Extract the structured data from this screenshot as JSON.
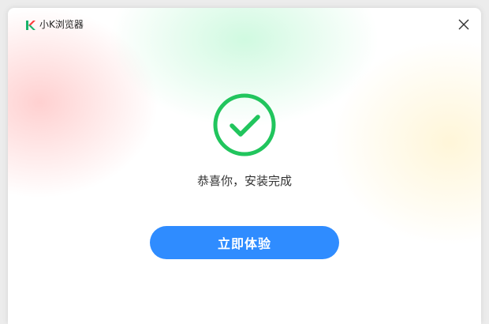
{
  "window": {
    "title": "小K浏览器",
    "logo_icon": "k-logo-icon",
    "close_icon": "close-icon"
  },
  "result": {
    "status_icon": "check-circle-icon",
    "message": "恭喜你，安装完成"
  },
  "actions": {
    "primary_label": "立即体验"
  },
  "colors": {
    "success_green": "#21c55d",
    "primary_blue": "#2f8cff",
    "logo_green": "#19b36b",
    "logo_red": "#ff3b3b"
  }
}
